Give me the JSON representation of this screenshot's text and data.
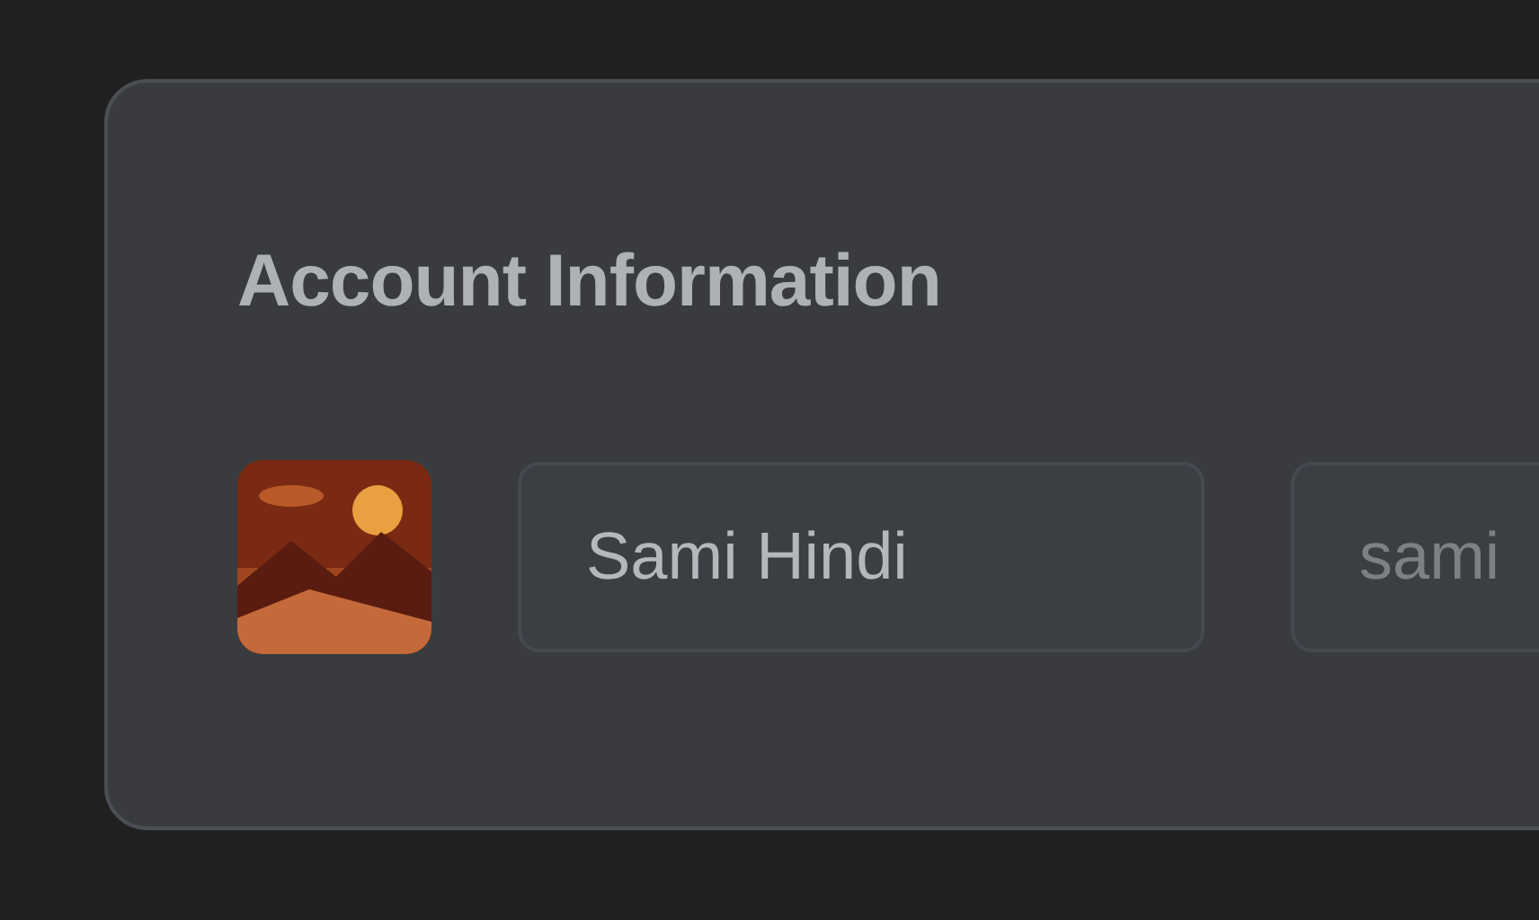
{
  "card": {
    "title": "Account Information",
    "fields": [
      {
        "value": "Sami Hindi"
      },
      {
        "placeholder": "sami"
      }
    ]
  }
}
